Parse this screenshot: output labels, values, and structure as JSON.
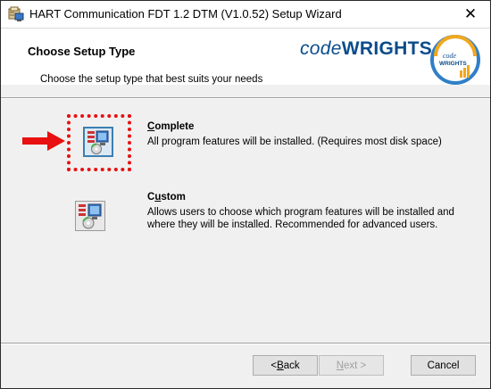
{
  "window": {
    "title": "HART Communication FDT 1.2 DTM (V1.0.52) Setup Wizard",
    "close_glyph": "✕"
  },
  "banner": {
    "title": "Choose Setup Type",
    "subtitle": "Choose the setup type that best suits your needs",
    "brand_prefix": "code",
    "brand_suffix": "WRIGHTS",
    "logo_text_top": "code",
    "logo_text_bottom": "WRIGHTS"
  },
  "options": [
    {
      "title_hotkey": "C",
      "title_rest": "omplete",
      "description": "All program features will be installed.  (Requires most disk space)",
      "selected": true
    },
    {
      "title_first": "C",
      "title_hotkey": "u",
      "title_rest": "stom",
      "description": "Allows users to choose which program features will be installed and where they will be installed. Recommended for advanced users.",
      "selected": false
    }
  ],
  "buttons": {
    "back_prefix": "< ",
    "back_hotkey": "B",
    "back_rest": "ack",
    "next_hotkey": "N",
    "next_rest": "ext >",
    "cancel_label": "Cancel"
  },
  "colors": {
    "brand": "#0b4c8c",
    "highlight": "#e81010",
    "selected_border": "#3c7fb1"
  },
  "icons": [
    "installer-icon",
    "close-icon",
    "codewrights-logo",
    "setup-type-complete-icon",
    "setup-type-custom-icon",
    "red-arrow-icon"
  ]
}
